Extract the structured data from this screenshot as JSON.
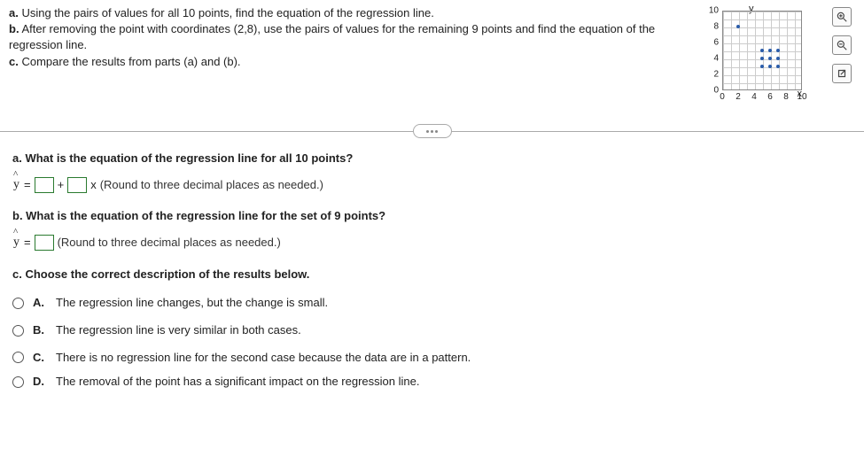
{
  "question": {
    "a_prefix": "a.",
    "a_text": " Using the pairs of values for all 10 points, find the equation of the regression line.",
    "b_prefix": "b.",
    "b_text": " After removing the point with coordinates (2,8), use the pairs of values for the remaining 9 points and find the equation of the regression line.",
    "c_prefix": "c.",
    "c_text": " Compare the results from parts (a) and (b)."
  },
  "parts": {
    "a_q": "a. What is the equation of the regression line for all 10 points?",
    "a_hint": "(Round to three decimal places as needed.)",
    "a_eq_y": "y",
    "a_eq_eq": "=",
    "a_eq_plus": "+",
    "a_eq_x": "x",
    "b_q": "b. What is the equation of the regression line for the set of 9 points?",
    "b_hint": "(Round to three decimal places as needed.)",
    "b_eq_y": "y",
    "b_eq_eq": "=",
    "c_q": "c. Choose the correct description of the results below."
  },
  "options": {
    "A_label": "A.",
    "A_text": "The regression line changes, but the change is small.",
    "B_label": "B.",
    "B_text": "The regression line is very similar in both cases.",
    "C_label": "C.",
    "C_text": "There is no regression line for the second case because the data are in a pattern.",
    "D_label": "D.",
    "D_text": "The removal of the point has a significant impact on the regression line."
  },
  "chart_data": {
    "type": "scatter",
    "title": "",
    "xlabel": "x",
    "ylabel": "y",
    "xlim": [
      0,
      10
    ],
    "ylim": [
      0,
      10
    ],
    "x_ticks": [
      0,
      2,
      4,
      6,
      8,
      10
    ],
    "y_ticks": [
      0,
      2,
      4,
      6,
      8,
      10
    ],
    "points": [
      {
        "x": 2,
        "y": 8
      },
      {
        "x": 5,
        "y": 3
      },
      {
        "x": 5,
        "y": 4
      },
      {
        "x": 5,
        "y": 5
      },
      {
        "x": 6,
        "y": 3
      },
      {
        "x": 6,
        "y": 4
      },
      {
        "x": 6,
        "y": 5
      },
      {
        "x": 7,
        "y": 3
      },
      {
        "x": 7,
        "y": 4
      },
      {
        "x": 7,
        "y": 5
      }
    ]
  }
}
